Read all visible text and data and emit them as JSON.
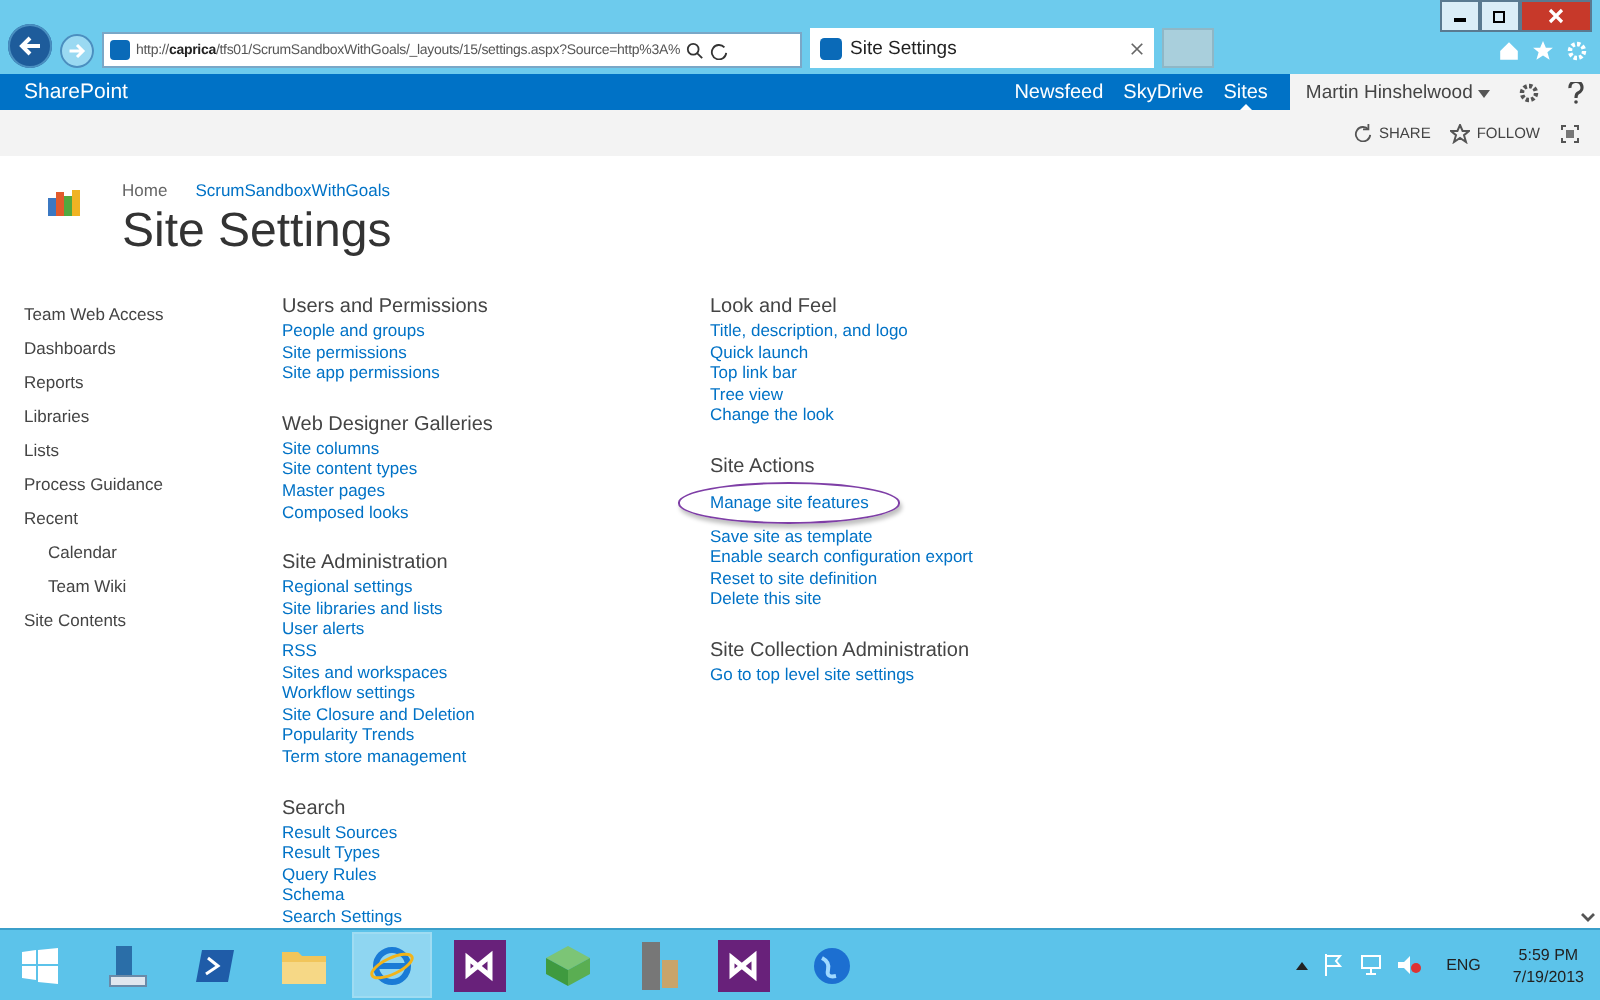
{
  "browser": {
    "url_prefix": "http://",
    "url_host": "caprica",
    "url_rest": "/tfs01/ScrumSandboxWithGoals/_layouts/15/settings.aspx?Source=http%3A%",
    "tab_title": "Site Settings"
  },
  "suite_bar": {
    "brand": "SharePoint",
    "links": [
      {
        "label": "Newsfeed",
        "selected": false
      },
      {
        "label": "SkyDrive",
        "selected": false
      },
      {
        "label": "Sites",
        "selected": true
      }
    ],
    "user": "Martin Hinshelwood"
  },
  "actions": [
    {
      "kind": "share",
      "label": "SHARE"
    },
    {
      "kind": "follow",
      "label": "FOLLOW"
    }
  ],
  "breadcrumb": [
    {
      "label": "Home",
      "link": false
    },
    {
      "label": "ScrumSandboxWithGoals",
      "link": true
    }
  ],
  "title": "Site Settings",
  "nav": [
    {
      "label": "Team Web Access"
    },
    {
      "label": "Dashboards"
    },
    {
      "label": "Reports"
    },
    {
      "label": "Libraries"
    },
    {
      "label": "Lists"
    },
    {
      "label": "Process Guidance"
    },
    {
      "label": "Recent",
      "children": [
        {
          "label": "Calendar"
        },
        {
          "label": "Team Wiki"
        }
      ]
    },
    {
      "label": "Site Contents"
    }
  ],
  "columns": [
    [
      {
        "heading": "Users and Permissions",
        "links": [
          {
            "label": "People and groups"
          },
          {
            "label": "Site permissions"
          },
          {
            "label": "Site app permissions"
          }
        ]
      },
      {
        "heading": "Web Designer Galleries",
        "links": [
          {
            "label": "Site columns"
          },
          {
            "label": "Site content types"
          },
          {
            "label": "Master pages"
          },
          {
            "label": "Composed looks"
          }
        ]
      },
      {
        "heading": "Site Administration",
        "links": [
          {
            "label": "Regional settings"
          },
          {
            "label": "Site libraries and lists"
          },
          {
            "label": "User alerts"
          },
          {
            "label": "RSS"
          },
          {
            "label": "Sites and workspaces"
          },
          {
            "label": "Workflow settings"
          },
          {
            "label": "Site Closure and Deletion"
          },
          {
            "label": "Popularity Trends"
          },
          {
            "label": "Term store management"
          }
        ]
      },
      {
        "heading": "Search",
        "links": [
          {
            "label": "Result Sources"
          },
          {
            "label": "Result Types"
          },
          {
            "label": "Query Rules"
          },
          {
            "label": "Schema"
          },
          {
            "label": "Search Settings"
          }
        ]
      }
    ],
    [
      {
        "heading": "Look and Feel",
        "links": [
          {
            "label": "Title, description, and logo"
          },
          {
            "label": "Quick launch"
          },
          {
            "label": "Top link bar"
          },
          {
            "label": "Tree view"
          },
          {
            "label": "Change the look"
          }
        ]
      },
      {
        "heading": "Site Actions",
        "links": [
          {
            "label": "Manage site features",
            "circled": true
          },
          {
            "label": "Save site as template",
            "circled": false
          },
          {
            "label": "Enable search configuration export",
            "circled": false
          },
          {
            "label": "Reset to site definition",
            "circled": false
          },
          {
            "label": "Delete this site",
            "circled": false
          }
        ]
      },
      {
        "heading": "Site Collection Administration",
        "links": [
          {
            "label": "Go to top level site settings"
          }
        ]
      }
    ]
  ],
  "taskbar": {
    "apps": [
      {
        "kind": "server",
        "selected": false
      },
      {
        "kind": "shell",
        "selected": false
      },
      {
        "kind": "folder",
        "selected": false
      },
      {
        "kind": "browser",
        "selected": true
      },
      {
        "kind": "studio",
        "selected": false
      },
      {
        "kind": "cube",
        "selected": false
      },
      {
        "kind": "rack",
        "selected": false
      },
      {
        "kind": "studio",
        "selected": false
      },
      {
        "kind": "globe",
        "selected": false
      }
    ],
    "language": "ENG",
    "time": "5:59 PM",
    "date": "7/19/2013"
  }
}
